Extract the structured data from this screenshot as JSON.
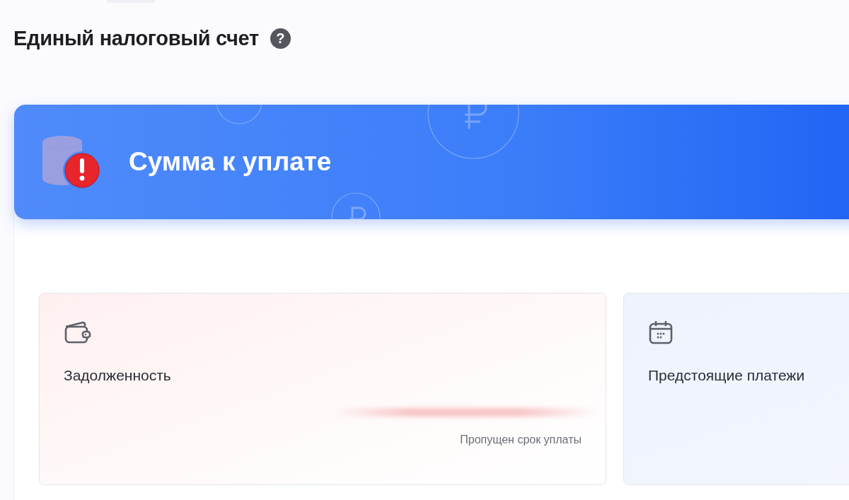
{
  "page_title": "Единый налоговый счет",
  "help_icon": "?",
  "banner": {
    "title": "Сумма к уплате",
    "alert": true
  },
  "cards": [
    {
      "kind": "debt",
      "title": "Задолженность",
      "note": "Пропущен срок уплаты"
    },
    {
      "kind": "upcoming",
      "title": "Предстоящие платежи"
    }
  ]
}
